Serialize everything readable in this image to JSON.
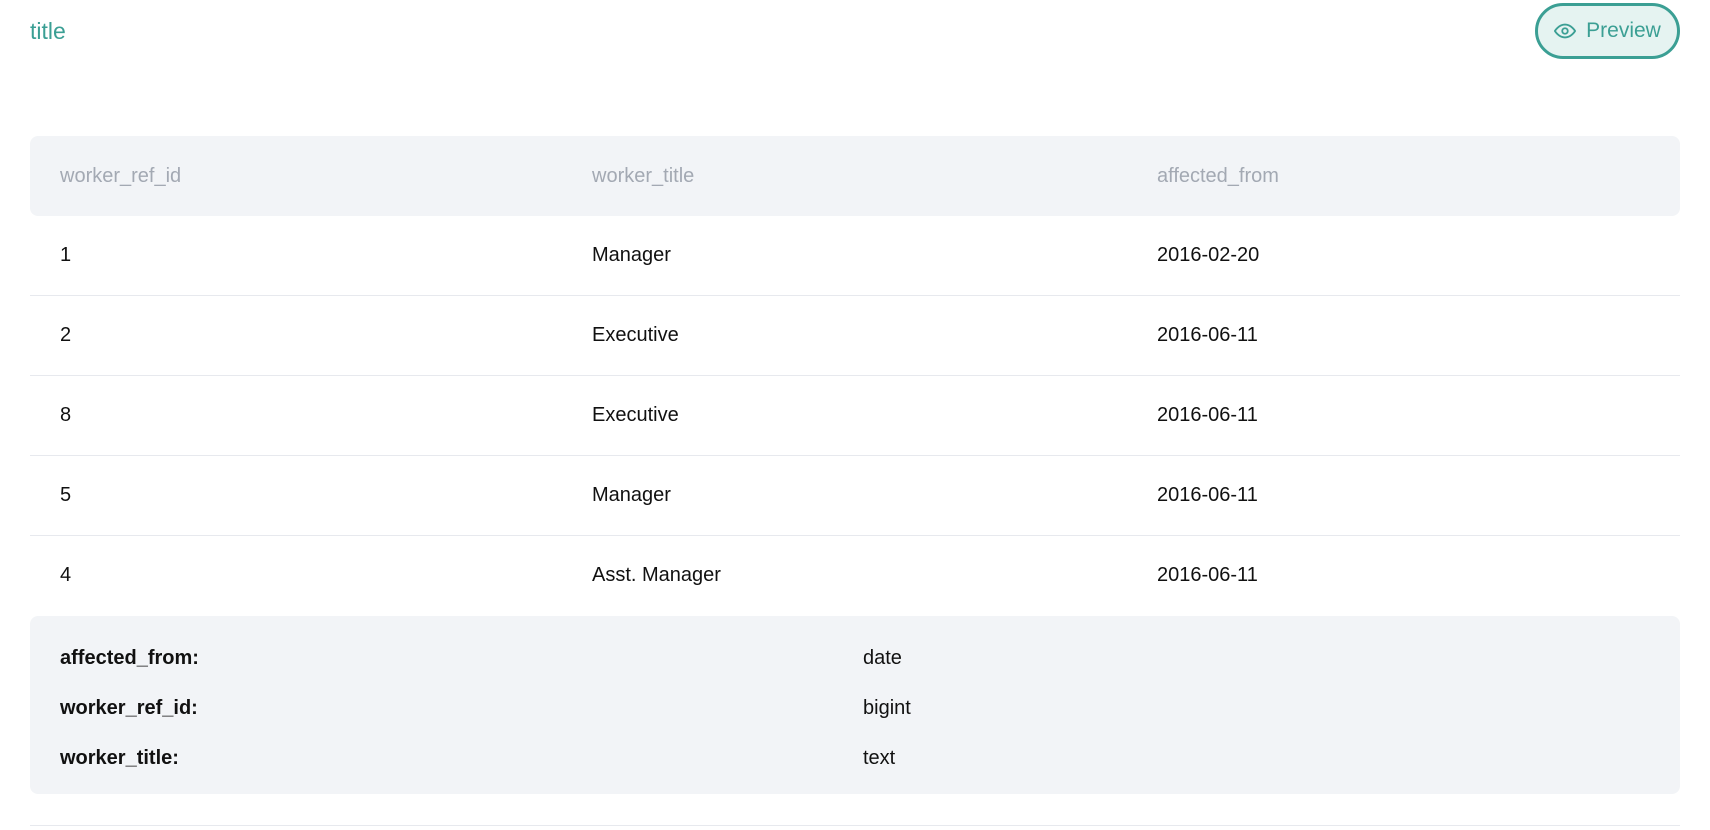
{
  "header": {
    "title": "title",
    "preview_label": "Preview",
    "preview_icon": "eye-icon",
    "accent_color": "#3b9f94"
  },
  "table": {
    "columns": [
      "worker_ref_id",
      "worker_title",
      "affected_from"
    ],
    "rows": [
      [
        "1",
        "Manager",
        "2016-02-20"
      ],
      [
        "2",
        "Executive",
        "2016-06-11"
      ],
      [
        "8",
        "Executive",
        "2016-06-11"
      ],
      [
        "5",
        "Manager",
        "2016-06-11"
      ],
      [
        "4",
        "Asst. Manager",
        "2016-06-11"
      ]
    ]
  },
  "schema": [
    {
      "name": "affected_from:",
      "type": "date"
    },
    {
      "name": "worker_ref_id:",
      "type": "bigint"
    },
    {
      "name": "worker_title:",
      "type": "text"
    }
  ]
}
